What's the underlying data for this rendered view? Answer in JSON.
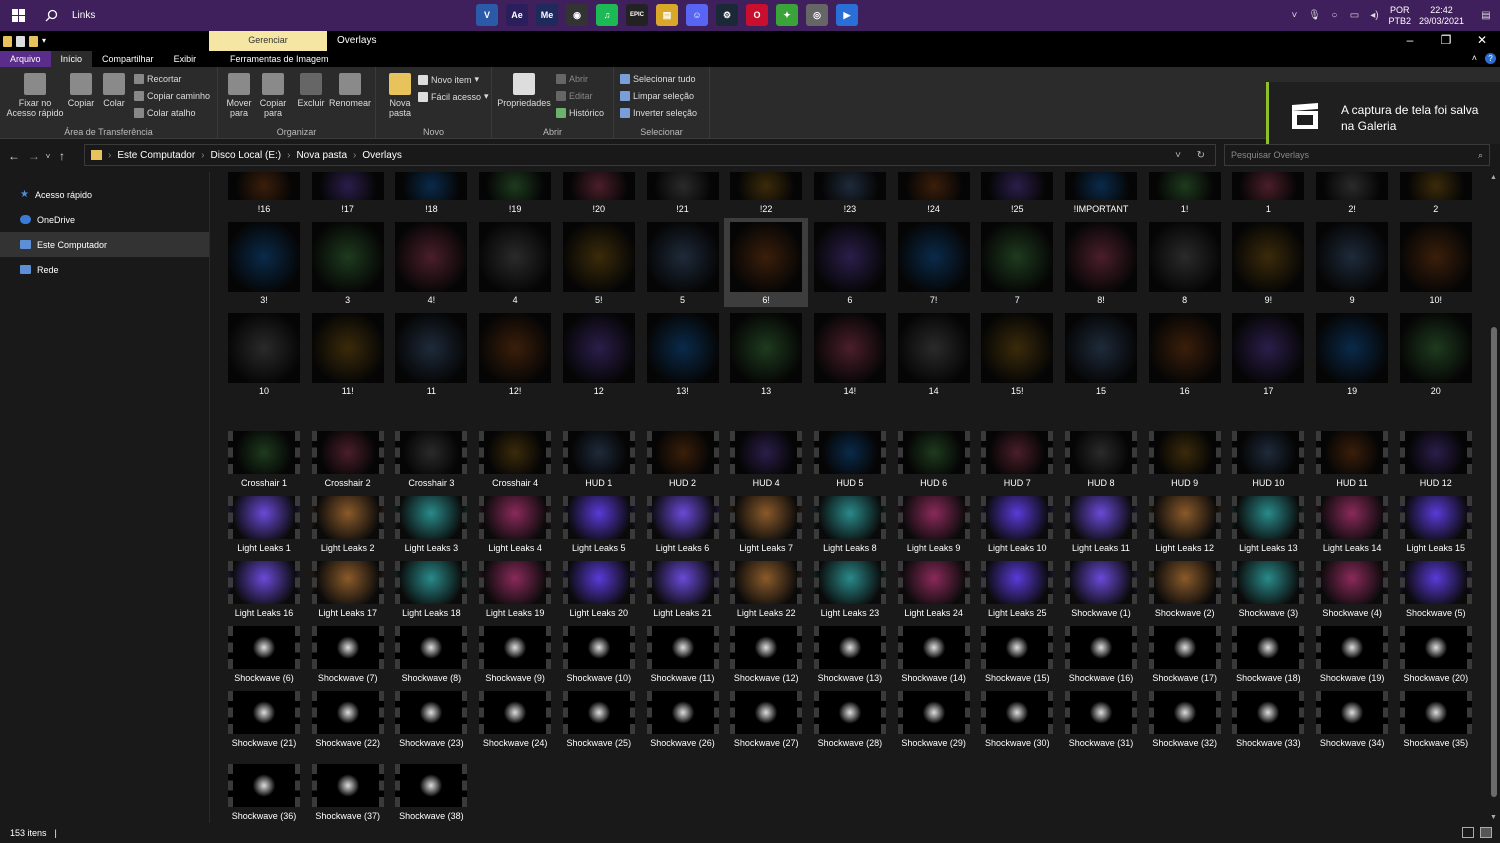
{
  "taskbar": {
    "search_label": "Links",
    "apps": [
      {
        "icon": "vstudio-icon",
        "glyph": "V",
        "color": "#2a5aa8"
      },
      {
        "icon": "after-effects-icon",
        "glyph": "Ae",
        "color": "#2a1f5c"
      },
      {
        "icon": "media-encoder-icon",
        "glyph": "Me",
        "color": "#1f2a5c"
      },
      {
        "icon": "obs-icon",
        "glyph": "◉",
        "color": "#333333"
      },
      {
        "icon": "spotify-icon",
        "glyph": "♫",
        "color": "#1db954"
      },
      {
        "icon": "epic-games-icon",
        "glyph": "EPIC",
        "color": "#222222"
      },
      {
        "icon": "file-explorer-icon",
        "glyph": "▤",
        "color": "#d9a82a"
      },
      {
        "icon": "discord-icon",
        "glyph": "☺",
        "color": "#5865f2"
      },
      {
        "icon": "steam-icon",
        "glyph": "⚙",
        "color": "#1b2838"
      },
      {
        "icon": "opera-gx-icon",
        "glyph": "O",
        "color": "#c8102e"
      },
      {
        "icon": "bluestacks-icon",
        "glyph": "✦",
        "color": "#3aa33a"
      },
      {
        "icon": "disc-icon",
        "glyph": "◎",
        "color": "#666666"
      },
      {
        "icon": "video-app-icon",
        "glyph": "▶",
        "color": "#2a6fd8"
      }
    ],
    "lang_top": "POR",
    "lang_bottom": "PTB2",
    "time": "22:42",
    "date": "29/03/2021"
  },
  "titlebar": {
    "manage": "Gerenciar",
    "title": "Overlays"
  },
  "ribbon_tabs": {
    "file": "Arquivo",
    "home": "Início",
    "share": "Compartilhar",
    "view": "Exibir",
    "tools": "Ferramentas de Imagem"
  },
  "ribbon": {
    "pin": "Fixar no Acesso rápido",
    "copy": "Copiar",
    "paste": "Colar",
    "cut": "Recortar",
    "copy_path": "Copiar caminho",
    "paste_shortcut": "Colar atalho",
    "clipboard_group": "Área de Transferência",
    "move_to": "Mover para",
    "copy_to": "Copiar para",
    "delete": "Excluir",
    "rename": "Renomear",
    "organize_group": "Organizar",
    "new_folder": "Nova pasta",
    "new_item": "Novo item",
    "easy_access": "Fácil acesso",
    "new_group": "Novo",
    "properties": "Propriedades",
    "open": "Abrir",
    "edit": "Editar",
    "history": "Histórico",
    "open_group": "Abrir",
    "select_all": "Selecionar tudo",
    "select_none": "Limpar seleção",
    "invert_selection": "Inverter seleção",
    "select_group": "Selecionar"
  },
  "toast": {
    "line1": "A captura de tela foi salva",
    "line2": "na Galeria"
  },
  "address": {
    "segments": [
      "Este Computador",
      "Disco Local (E:)",
      "Nova pasta",
      "Overlays"
    ],
    "search_placeholder": "Pesquisar Overlays"
  },
  "nav": [
    {
      "label": "Acesso rápido",
      "icon": "star-icon",
      "color": "#4a90e2"
    },
    {
      "label": "OneDrive",
      "icon": "cloud-icon",
      "color": "#3a7bd5"
    },
    {
      "label": "Este Computador",
      "icon": "computer-icon",
      "color": "#5b8fd6"
    },
    {
      "label": "Rede",
      "icon": "network-icon",
      "color": "#5b8fd6"
    }
  ],
  "files": {
    "row0": [
      "!16",
      "!17",
      "!18",
      "!19",
      "!20",
      "!21",
      "!22",
      "!23",
      "!24",
      "!25",
      "!IMPORTANT",
      "1!",
      "1",
      "2!",
      "2"
    ],
    "row1": [
      "3!",
      "3",
      "4!",
      "4",
      "5!",
      "5",
      "6!",
      "6",
      "7!",
      "7",
      "8!",
      "8",
      "9!",
      "9",
      "10!"
    ],
    "row2": [
      "10",
      "11!",
      "11",
      "12!",
      "12",
      "13!",
      "13",
      "14!",
      "14",
      "15!",
      "15",
      "16",
      "17",
      "19",
      "20"
    ],
    "row3": [
      "Crosshair 1",
      "Crosshair 2",
      "Crosshair 3",
      "Crosshair 4",
      "HUD 1",
      "HUD 2",
      "HUD 4",
      "HUD 5",
      "HUD 6",
      "HUD 7",
      "HUD 8",
      "HUD 9",
      "HUD 10",
      "HUD 11",
      "HUD 12"
    ],
    "row4": [
      "Light Leaks 1",
      "Light Leaks 2",
      "Light Leaks 3",
      "Light Leaks 4",
      "Light Leaks 5",
      "Light Leaks 6",
      "Light Leaks 7",
      "Light Leaks 8",
      "Light Leaks 9",
      "Light Leaks 10",
      "Light Leaks 11",
      "Light Leaks 12",
      "Light Leaks 13",
      "Light Leaks 14",
      "Light Leaks 15"
    ],
    "row5": [
      "Light Leaks 16",
      "Light Leaks 17",
      "Light Leaks 18",
      "Light Leaks 19",
      "Light Leaks 20",
      "Light Leaks 21",
      "Light Leaks 22",
      "Light Leaks 23",
      "Light Leaks 24",
      "Light Leaks 25",
      "Shockwave (1)",
      "Shockwave (2)",
      "Shockwave (3)",
      "Shockwave (4)",
      "Shockwave (5)"
    ],
    "row6": [
      "Shockwave (6)",
      "Shockwave (7)",
      "Shockwave (8)",
      "Shockwave (9)",
      "Shockwave (10)",
      "Shockwave (11)",
      "Shockwave (12)",
      "Shockwave (13)",
      "Shockwave (14)",
      "Shockwave (15)",
      "Shockwave (16)",
      "Shockwave (17)",
      "Shockwave (18)",
      "Shockwave (19)",
      "Shockwave (20)"
    ],
    "row7": [
      "Shockwave (21)",
      "Shockwave (22)",
      "Shockwave (23)",
      "Shockwave (24)",
      "Shockwave (25)",
      "Shockwave (26)",
      "Shockwave (27)",
      "Shockwave (28)",
      "Shockwave (29)",
      "Shockwave (30)",
      "Shockwave (31)",
      "Shockwave (32)",
      "Shockwave (33)",
      "Shockwave (34)",
      "Shockwave (35)"
    ],
    "row8": [
      "Shockwave (36)",
      "Shockwave (37)",
      "Shockwave (38)"
    ]
  },
  "selected_file": "6!",
  "status": {
    "count": "153 itens"
  },
  "colors": {
    "taskbar": "#3f1f5c",
    "accent": "#5a2d8a",
    "toast_accent": "#8fbf2a",
    "manage_tab": "#f5e7a3"
  }
}
